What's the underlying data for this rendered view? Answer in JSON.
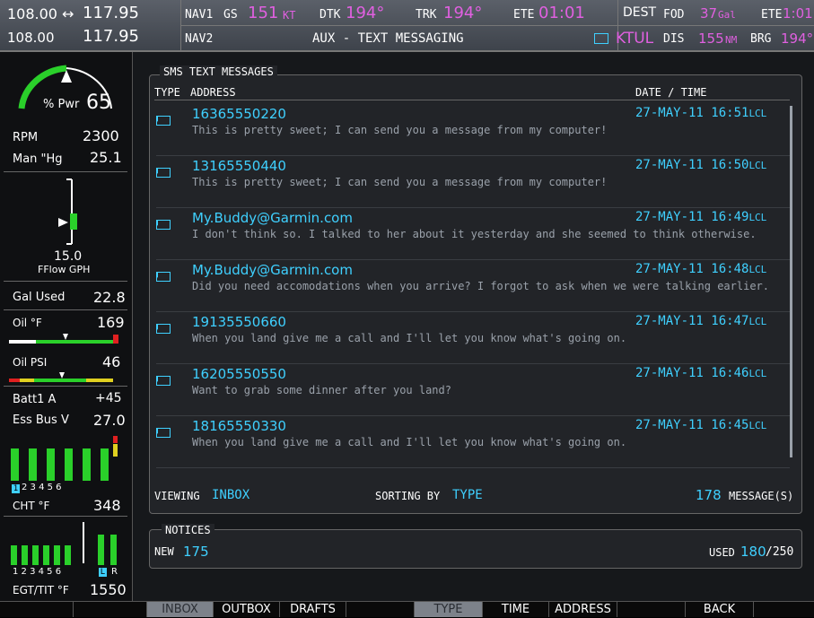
{
  "topbar": {
    "com1": "108.00 ↔",
    "com1_standby": "117.95",
    "com2": "108.00",
    "com2_standby": "117.95",
    "nav1_label": "NAV1",
    "nav2_label": "NAV2",
    "gs_label": "GS",
    "gs_value": "151",
    "gs_unit": "KT",
    "dtk_label": "DTK",
    "dtk_value": "194°",
    "trk_label": "TRK",
    "trk_value": "194°",
    "ete_label": "ETE",
    "ete_value": "01:01",
    "page_title": "AUX - TEXT MESSAGING",
    "dest_label": "DEST",
    "dest_value": "KTUL",
    "fod_label": "FOD",
    "fod_value": "37",
    "fod_unit": "Gal",
    "ete2_label": "ETE",
    "ete2_value": "1:01",
    "dis_label": "DIS",
    "dis_value": "155",
    "dis_unit": "NM",
    "brg_label": "BRG",
    "brg_value": "194°"
  },
  "engine": {
    "pwr_label": "% Pwr",
    "pwr_value": "65",
    "rpm_label": "RPM",
    "rpm_value": "2300",
    "man_label": "Man \"Hg",
    "man_value": "25.1",
    "fflow_value": "15.0",
    "fflow_label": "FFlow GPH",
    "galused_label": "Gal Used",
    "galused_value": "22.8",
    "oilf_label": "Oil °F",
    "oilf_value": "169",
    "oilpsi_label": "Oil PSI",
    "oilpsi_value": "46",
    "batt_label": "Batt1 A",
    "batt_value": "+45",
    "essbus_label": "Ess Bus V",
    "essbus_value": "27.0",
    "cyl_numbers": "2 3 4 5 6",
    "cyl_selected": "1",
    "cht_label": "CHT °F",
    "cht_value": "348",
    "egt_numbers": "1 2 3 4 5 6",
    "lr_l": "L",
    "lr_r": "R",
    "egt_label": "EGT/TIT °F",
    "egt_value": "1550"
  },
  "sms": {
    "box_title": "SMS TEXT MESSAGES",
    "col_type": "TYPE",
    "col_address": "ADDRESS",
    "col_datetime": "DATE / TIME",
    "messages": [
      {
        "address": "16365550220",
        "text": "This is pretty sweet; I can send you a message from my computer!",
        "datetime": "27-MAY-11  16:51",
        "lcl": "LCL"
      },
      {
        "address": "13165550440",
        "text": "This is pretty sweet; I can send you a message from my computer!",
        "datetime": "27-MAY-11  16:50",
        "lcl": "LCL"
      },
      {
        "address": "My.Buddy@Garmin.com",
        "text": "I don't think so. I talked to her about it yesterday and she seemed to think otherwise.",
        "datetime": "27-MAY-11  16:49",
        "lcl": "LCL"
      },
      {
        "address": "My.Buddy@Garmin.com",
        "text": "Did you need accomodations when you arrive? I forgot to ask when we were talking earlier.",
        "datetime": "27-MAY-11  16:48",
        "lcl": "LCL"
      },
      {
        "address": "19135550660",
        "text": "When you land give me a call and I'll let you know what's going on.",
        "datetime": "27-MAY-11  16:47",
        "lcl": "LCL"
      },
      {
        "address": "16205550550",
        "text": "Want to grab some dinner after you land?",
        "datetime": "27-MAY-11  16:46",
        "lcl": "LCL"
      },
      {
        "address": "18165550330",
        "text": "When you land give me a call and I'll let you know what's going on.",
        "datetime": "27-MAY-11  16:45",
        "lcl": "LCL"
      }
    ],
    "viewing_label": "VIEWING",
    "viewing_value": "INBOX",
    "sorting_label": "SORTING BY",
    "sorting_value": "TYPE",
    "count_value": "178",
    "count_label": "MESSAGE(S)"
  },
  "notices": {
    "title": "NOTICES",
    "new_label": "NEW",
    "new_value": "175",
    "used_label": "USED",
    "used_value": "180",
    "used_total": "/250"
  },
  "softkeys": [
    "INBOX",
    "OUTBOX",
    "DRAFTS",
    "TYPE",
    "TIME",
    "ADDRESS",
    "BACK"
  ],
  "colors": {
    "cyan": "#3fd0ff",
    "magenta": "#e060e0",
    "green": "#2ad02a",
    "active_key": "#7d828a"
  }
}
